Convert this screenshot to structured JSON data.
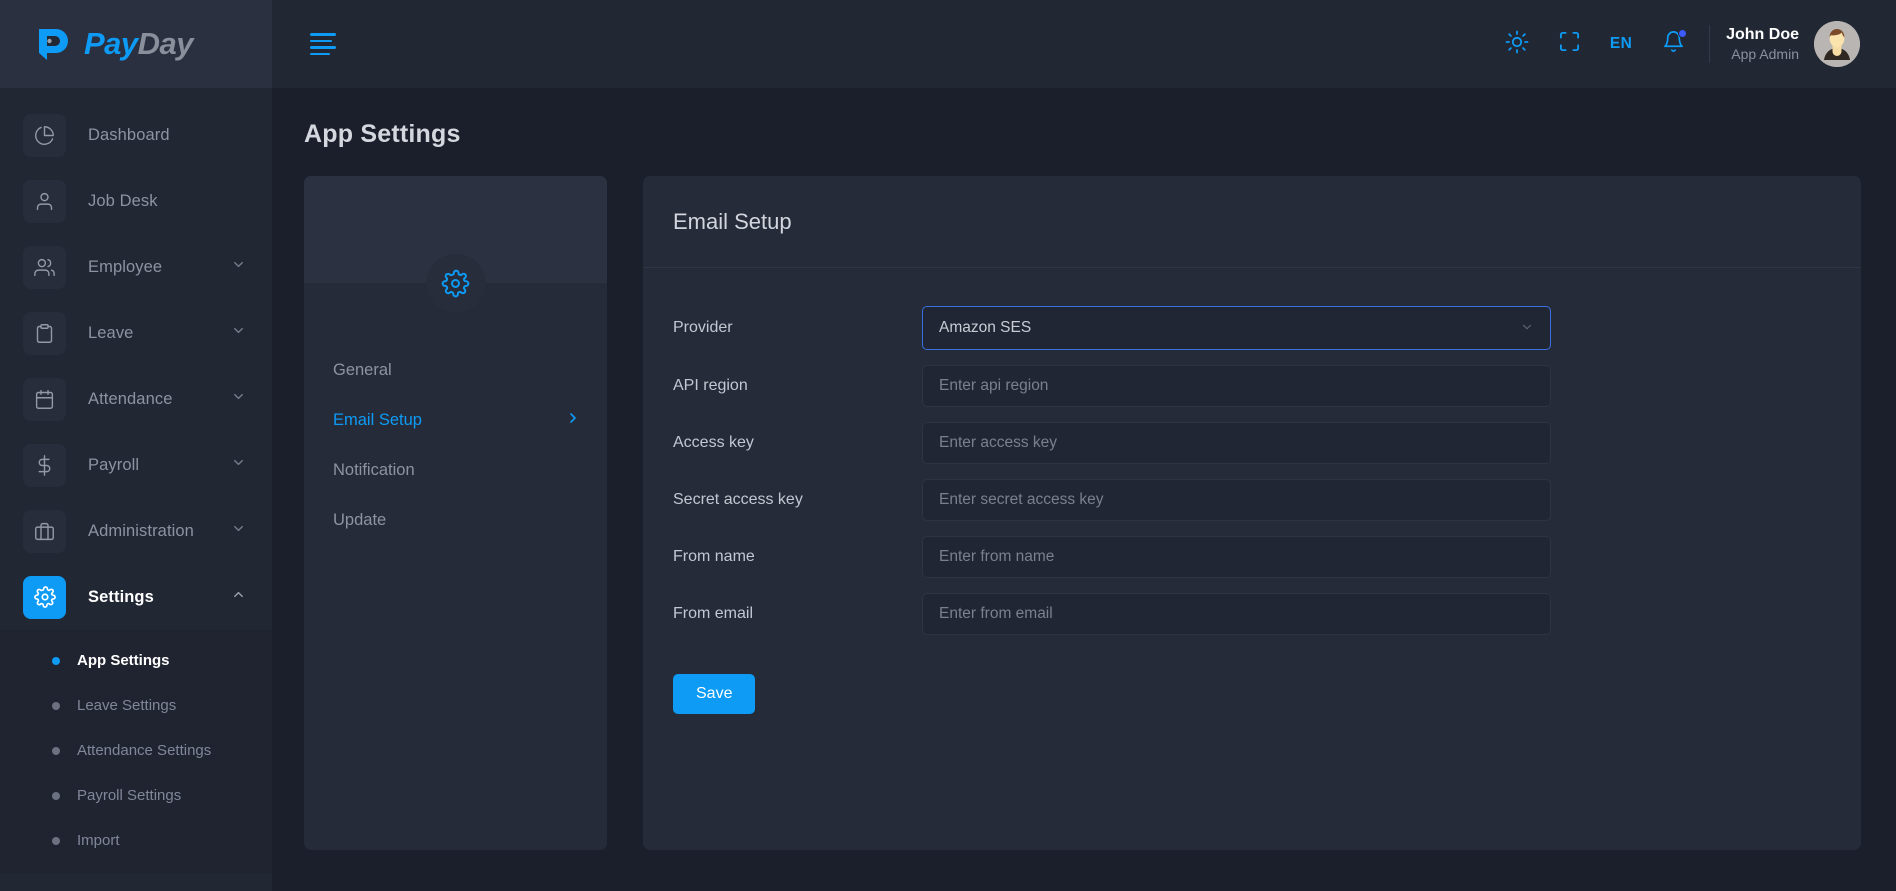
{
  "brand": {
    "pay": "Pay",
    "day": "Day",
    "mark_icon": "payday-logo-icon"
  },
  "sidebar": {
    "items": [
      {
        "label": "Dashboard",
        "icon": "pie-chart-icon",
        "caret": ""
      },
      {
        "label": "Job Desk",
        "icon": "user-icon",
        "caret": ""
      },
      {
        "label": "Employee",
        "icon": "users-icon",
        "caret": "chevron-down"
      },
      {
        "label": "Leave",
        "icon": "clipboard-icon",
        "caret": "chevron-down"
      },
      {
        "label": "Attendance",
        "icon": "calendar-icon",
        "caret": "chevron-down"
      },
      {
        "label": "Payroll",
        "icon": "dollar-icon",
        "caret": "chevron-down"
      },
      {
        "label": "Administration",
        "icon": "briefcase-icon",
        "caret": "chevron-down"
      },
      {
        "label": "Settings",
        "icon": "gear-icon",
        "caret": "chevron-up",
        "active": true
      }
    ],
    "submenu": [
      {
        "label": "App Settings",
        "active": true
      },
      {
        "label": "Leave Settings",
        "active": false
      },
      {
        "label": "Attendance Settings",
        "active": false
      },
      {
        "label": "Payroll Settings",
        "active": false
      },
      {
        "label": "Import",
        "active": false
      }
    ]
  },
  "topbar": {
    "menu_toggle_icon": "hamburger-icon",
    "theme_icon": "sun-icon",
    "fullscreen_icon": "fullscreen-icon",
    "language": "EN",
    "notification_icon": "bell-icon",
    "user_name": "John Doe",
    "user_role": "App Admin",
    "avatar_icon": "user-avatar"
  },
  "page": {
    "title": "App Settings"
  },
  "settings_nav": {
    "header_icon": "gear-icon",
    "items": [
      {
        "label": "General",
        "active": false
      },
      {
        "label": "Email Setup",
        "active": true
      },
      {
        "label": "Notification",
        "active": false
      },
      {
        "label": "Update",
        "active": false
      }
    ]
  },
  "email_setup": {
    "title": "Email Setup",
    "provider": {
      "label": "Provider",
      "value": "Amazon SES",
      "chevron_icon": "chevron-down-icon"
    },
    "fields": [
      {
        "label": "API region",
        "value": "",
        "placeholder": "Enter api region"
      },
      {
        "label": "Access key",
        "value": "",
        "placeholder": "Enter access key"
      },
      {
        "label": "Secret access key",
        "value": "",
        "placeholder": "Enter secret access key"
      },
      {
        "label": "From name",
        "value": "",
        "placeholder": "Enter from name"
      },
      {
        "label": "From email",
        "value": "",
        "placeholder": "Enter from email"
      }
    ],
    "save_label": "Save"
  },
  "colors": {
    "accent": "#0d9bf5",
    "sidebar_bg": "#222734",
    "content_bg": "#1b1f2b",
    "card_bg": "#262b39",
    "focus_border": "#3a6fe0",
    "badge": "#3b5bfd"
  }
}
